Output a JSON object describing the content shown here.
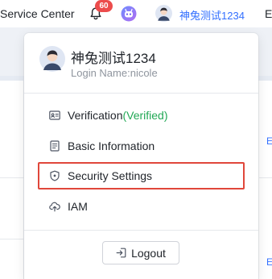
{
  "header": {
    "service_center": "Service Center",
    "notification_count": "60",
    "username": "神兔测试1234",
    "edge_letter": "E"
  },
  "dropdown": {
    "display_name": "神兔测试1234",
    "login_name": "Login Name:nicole",
    "menu": {
      "verification_label": "Verification",
      "verification_status": "(Verified)",
      "basic_info": "Basic Information",
      "security_settings": "Security Settings",
      "iam": "IAM"
    },
    "logout": "Logout"
  },
  "background": {
    "right_ticks": [
      "E",
      "E"
    ]
  },
  "colors": {
    "accent": "#3370ff",
    "verified": "#22a855",
    "badge": "#ec4c4c",
    "highlight_border": "#e0473b"
  }
}
